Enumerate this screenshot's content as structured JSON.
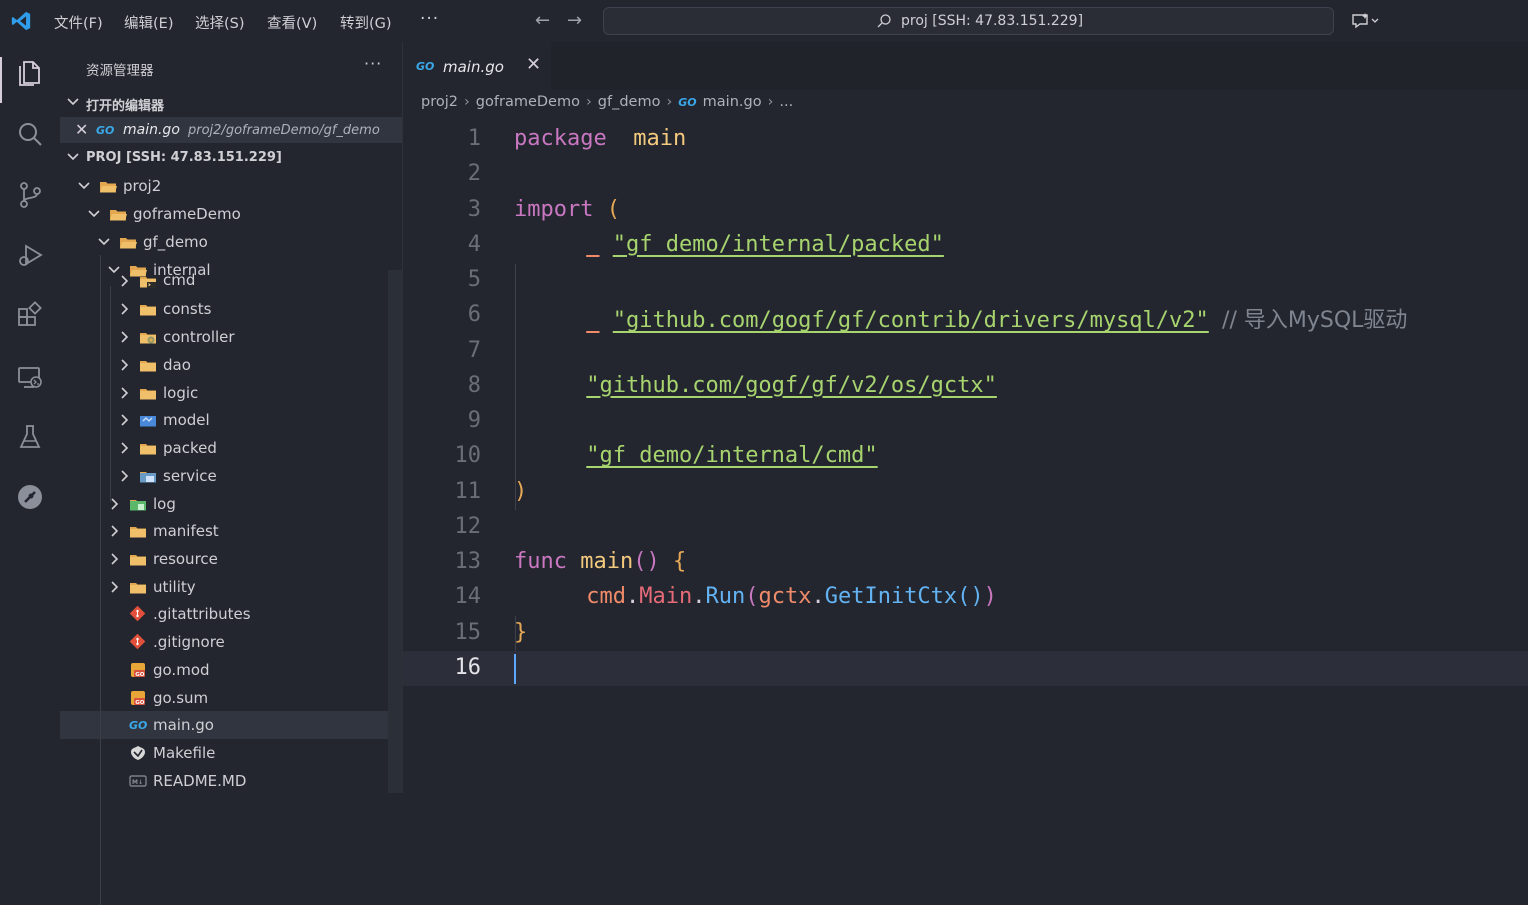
{
  "menubar": {
    "items": [
      "文件(F)",
      "编辑(E)",
      "选择(S)",
      "查看(V)",
      "转到(G)"
    ],
    "more": "···"
  },
  "command_center": {
    "text": "proj [SSH: 47.83.151.229]"
  },
  "sidebar": {
    "title": "资源管理器",
    "more": "···",
    "open_editors_label": "打开的编辑器",
    "open_editor": {
      "name": "main.go",
      "path": "proj2/goframeDemo/gf_demo",
      "icon_text": "GO"
    },
    "workspace_label": "PROJ [SSH: 47.83.151.229]",
    "tree": [
      {
        "label": "proj2",
        "icon": "folder-open-icon",
        "expanded": true
      },
      {
        "label": "goframeDemo",
        "icon": "folder-open-icon",
        "expanded": true
      },
      {
        "label": "gf_demo",
        "icon": "folder-open-icon",
        "expanded": true
      },
      {
        "label": "internal",
        "icon": "folder-open-icon",
        "expanded": true
      },
      {
        "label": "cmd",
        "icon": "folder-cmd-icon",
        "expanded": false
      },
      {
        "label": "consts",
        "icon": "folder-icon",
        "expanded": false
      },
      {
        "label": "controller",
        "icon": "folder-controller-icon",
        "expanded": false
      },
      {
        "label": "dao",
        "icon": "folder-icon",
        "expanded": false
      },
      {
        "label": "logic",
        "icon": "folder-icon",
        "expanded": false
      },
      {
        "label": "model",
        "icon": "folder-model-icon",
        "expanded": false
      },
      {
        "label": "packed",
        "icon": "folder-icon",
        "expanded": false
      },
      {
        "label": "service",
        "icon": "folder-service-icon",
        "expanded": false
      },
      {
        "label": "log",
        "icon": "folder-log-icon",
        "expanded": false
      },
      {
        "label": "manifest",
        "icon": "folder-icon",
        "expanded": false
      },
      {
        "label": "resource",
        "icon": "folder-icon",
        "expanded": false
      },
      {
        "label": "utility",
        "icon": "folder-icon",
        "expanded": false
      },
      {
        "label": ".gitattributes",
        "icon": "git-icon"
      },
      {
        "label": ".gitignore",
        "icon": "git-icon"
      },
      {
        "label": "go.mod",
        "icon": "gomod-icon"
      },
      {
        "label": "go.sum",
        "icon": "gomod-icon"
      },
      {
        "label": "main.go",
        "icon": "go-file-icon",
        "selected": true
      },
      {
        "label": "Makefile",
        "icon": "makefile-icon"
      },
      {
        "label": "README.MD",
        "icon": "markdown-icon"
      }
    ]
  },
  "editor": {
    "tab": {
      "name": "main.go",
      "icon_text": "GO",
      "close": "✕"
    },
    "breadcrumb": [
      "proj2",
      "goframeDemo",
      "gf_demo",
      "main.go",
      "..."
    ],
    "current_line": 16,
    "lines": [
      [
        [
          "kw",
          "package"
        ],
        [
          "",
          "  "
        ],
        [
          "pkg",
          "main"
        ]
      ],
      [],
      [
        [
          "kw",
          "import"
        ],
        [
          "",
          " "
        ],
        [
          "paren",
          "("
        ]
      ],
      [
        [
          "",
          " "
        ],
        [
          "blank",
          "_"
        ],
        [
          "",
          " "
        ],
        [
          "str",
          "\"gf_demo/internal/packed\""
        ]
      ],
      [],
      [
        [
          "",
          " "
        ],
        [
          "blank",
          "_"
        ],
        [
          "",
          " "
        ],
        [
          "str",
          "\"github.com/gogf/gf/contrib/drivers/mysql/v2\""
        ],
        [
          "",
          " "
        ],
        [
          "cmt",
          "// 导入MySQL驱动"
        ]
      ],
      [],
      [
        [
          "",
          " "
        ],
        [
          "str",
          "\"github.com/gogf/gf/v2/os/gctx\""
        ]
      ],
      [],
      [
        [
          "",
          " "
        ],
        [
          "str",
          "\"gf_demo/internal/cmd\""
        ]
      ],
      [
        [
          "paren",
          ")"
        ]
      ],
      [],
      [
        [
          "kw",
          "func"
        ],
        [
          "",
          " "
        ],
        [
          "fnname",
          "main"
        ],
        [
          "paren2",
          "()"
        ],
        [
          "",
          " "
        ],
        [
          "paren",
          "{"
        ]
      ],
      [
        [
          "",
          " "
        ],
        [
          "ident",
          "cmd"
        ],
        [
          "",
          "."
        ],
        [
          "member",
          "Main"
        ],
        [
          "",
          "."
        ],
        [
          "method",
          "Run"
        ],
        [
          "paren2",
          "("
        ],
        [
          "ident",
          "gctx"
        ],
        [
          "",
          "."
        ],
        [
          "method",
          "GetInitCtx"
        ],
        [
          "fnlit",
          "()"
        ],
        [
          "paren2",
          ")"
        ]
      ],
      [
        [
          "paren",
          "}"
        ]
      ],
      []
    ]
  },
  "colors": {
    "background": "#23262e",
    "keyword": "#c877c0",
    "string": "#a7d46f",
    "function": "#63b3f3",
    "go_blue": "#3aa8e8",
    "folder": "#e3a84f"
  }
}
